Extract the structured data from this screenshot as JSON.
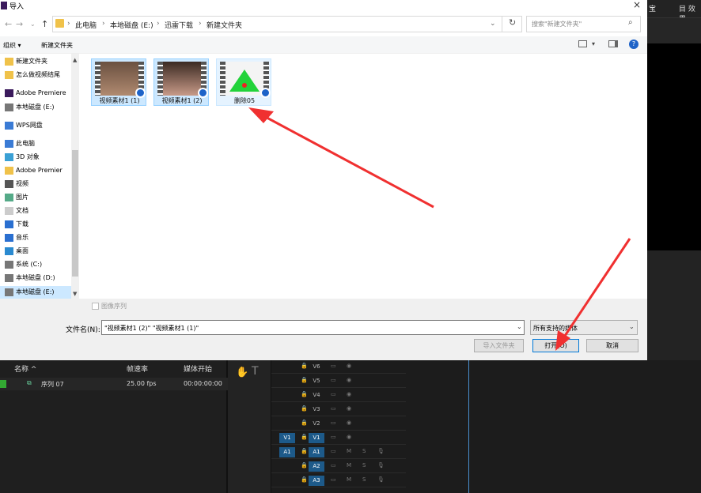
{
  "dialog": {
    "title": "导入",
    "close": "×",
    "address_path": [
      "此电脑",
      "本地磁盘 (E:)",
      "迅雷下载",
      "新建文件夹"
    ],
    "search_placeholder": "搜索\"新建文件夹\"",
    "toolbar": {
      "organize": "组织 ▾",
      "new_folder": "新建文件夹"
    },
    "nav_items": [
      {
        "label": "新建文件夹",
        "icon": "folder-icon"
      },
      {
        "label": "怎么做视频结尾",
        "icon": "folder-icon"
      },
      {
        "label": "Adobe Premiere",
        "icon": "premiere-icon"
      },
      {
        "label": "本地磁盘 (E:)",
        "icon": "drive-icon"
      },
      {
        "label": "WPS网盘",
        "icon": "cloud-icon"
      },
      {
        "label": "此电脑",
        "icon": "computer-icon"
      },
      {
        "label": "3D 对象",
        "icon": "cube-icon"
      },
      {
        "label": "Adobe Premier",
        "icon": "folder-icon"
      },
      {
        "label": "视频",
        "icon": "video-icon"
      },
      {
        "label": "图片",
        "icon": "picture-icon"
      },
      {
        "label": "文档",
        "icon": "document-icon"
      },
      {
        "label": "下载",
        "icon": "download-icon"
      },
      {
        "label": "音乐",
        "icon": "music-icon"
      },
      {
        "label": "桌面",
        "icon": "desktop-icon"
      },
      {
        "label": "系统 (C:)",
        "icon": "drive-icon"
      },
      {
        "label": "本地磁盘 (D:)",
        "icon": "drive-icon"
      },
      {
        "label": "本地磁盘 (E:)",
        "icon": "drive-icon"
      }
    ],
    "files": [
      {
        "name": "视频素材1 (1)"
      },
      {
        "name": "视频素材1 (2)"
      },
      {
        "name": "删除05"
      }
    ],
    "image_sequence_label": "图像序列",
    "filename_label": "文件名(N):",
    "filename_value": "\"视频素材1 (2)\" \"视频素材1 (1)\"",
    "filter_value": "所有支持的媒体",
    "import_folder_button": "导入文件夹",
    "open_button": "打开(O)",
    "cancel_button": "取消"
  },
  "premiere": {
    "top_labels": [
      "宝",
      "目 效果"
    ],
    "project_headers": [
      "名称 ^",
      "帧速率",
      "媒体开始"
    ],
    "project_row": {
      "name": "序列 07",
      "fps": "25.00 fps",
      "start": "00:00:00:00"
    },
    "video_tracks": [
      "V6",
      "V5",
      "V4",
      "V3",
      "V2",
      "V1"
    ],
    "audio_tracks": [
      "A1",
      "A2",
      "A3"
    ],
    "source_v1": "V1",
    "source_a1": "A1"
  },
  "colors": {
    "accent": "#f03030",
    "track_blue": "#1d5a8a",
    "selection": "#cce8ff"
  }
}
